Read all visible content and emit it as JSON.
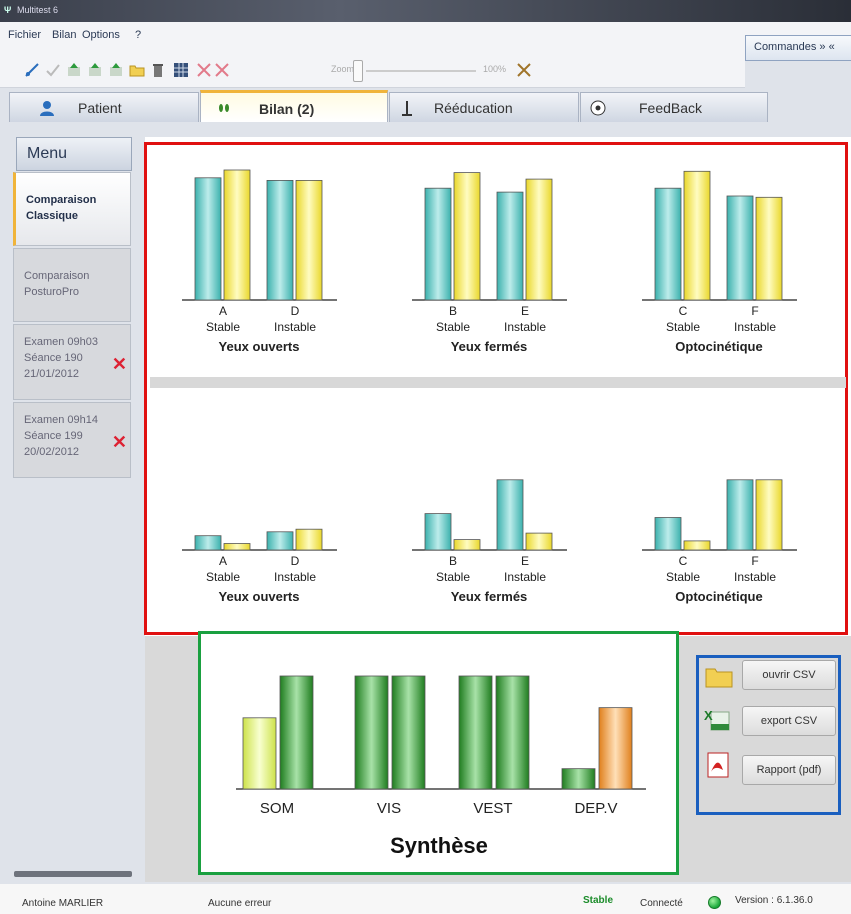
{
  "window": {
    "title": "Multitest 6"
  },
  "menu": {
    "items": [
      "Fichier",
      "Bilan",
      "Options",
      "?"
    ],
    "commands_button": "Commandes » «"
  },
  "toolbar": {
    "zoom_label": "Zoom :",
    "zoom_value": "100%"
  },
  "tabs": [
    {
      "label": "Patient",
      "active": false,
      "icon": "user-icon"
    },
    {
      "label": "Bilan (2)",
      "active": true,
      "icon": "footprints-icon"
    },
    {
      "label": "Rééducation",
      "active": false,
      "icon": "balance-icon"
    },
    {
      "label": "FeedBack",
      "active": false,
      "icon": "ball-icon"
    }
  ],
  "sidebar": {
    "header": "Menu",
    "items": [
      {
        "lines": [
          "Comparaison",
          "Classique"
        ],
        "active": true,
        "deletable": false
      },
      {
        "lines": [
          "Comparaison",
          "PosturoPro"
        ],
        "active": false,
        "deletable": false
      },
      {
        "lines": [
          "Examen 09h03",
          "Séance 190",
          "21/01/2012"
        ],
        "active": false,
        "deletable": true
      },
      {
        "lines": [
          "Examen 09h14",
          "Séance 199",
          "20/02/2012"
        ],
        "active": false,
        "deletable": true
      }
    ]
  },
  "actions": {
    "open_csv": "ouvrir CSV",
    "export_csv": "export CSV",
    "report_pdf": "Rapport (pdf)"
  },
  "status": {
    "user": "Antoine MARLIER",
    "error": "Aucune erreur",
    "state": "Stable",
    "connection": "Connecté",
    "version": "Version : 6.1.36.0"
  },
  "colors": {
    "teal": "#5cc4c0",
    "yellow": "#fff36a",
    "green": "#2f9a2f",
    "orange": "#f59c3a",
    "highlight_red": "#e01010",
    "highlight_green": "#1aa040",
    "highlight_blue": "#1a5fbf"
  },
  "chart_data": [
    {
      "type": "bar",
      "row": "top",
      "groups": [
        {
          "title": "Yeux ouverts",
          "categories": [
            "A\nStable",
            "D\nInstable"
          ],
          "series": [
            {
              "values": [
                0.94,
                0.92
              ]
            },
            {
              "values": [
                1.0,
                0.92
              ]
            }
          ]
        },
        {
          "title": "Yeux fermés",
          "categories": [
            "B\nStable",
            "E\nInstable"
          ],
          "series": [
            {
              "values": [
                0.86,
                0.83
              ]
            },
            {
              "values": [
                0.98,
                0.93
              ]
            }
          ]
        },
        {
          "title": "Optocinétique",
          "categories": [
            "C\nStable",
            "F\nInstable"
          ],
          "series": [
            {
              "values": [
                0.86,
                0.8
              ]
            },
            {
              "values": [
                0.99,
                0.79
              ]
            }
          ]
        }
      ]
    },
    {
      "type": "bar",
      "row": "bottom",
      "groups": [
        {
          "title": "Yeux ouverts",
          "categories": [
            "A\nStable",
            "D\nInstable"
          ],
          "series": [
            {
              "values": [
                0.11,
                0.14
              ]
            },
            {
              "values": [
                0.05,
                0.16
              ]
            }
          ]
        },
        {
          "title": "Yeux fermés",
          "categories": [
            "B\nStable",
            "E\nInstable"
          ],
          "series": [
            {
              "values": [
                0.28,
                0.54
              ]
            },
            {
              "values": [
                0.08,
                0.13
              ]
            }
          ]
        },
        {
          "title": "Optocinétique",
          "categories": [
            "C\nStable",
            "F\nInstable"
          ],
          "series": [
            {
              "values": [
                0.25,
                0.54
              ]
            },
            {
              "values": [
                0.07,
                0.54
              ]
            }
          ]
        }
      ]
    },
    {
      "type": "bar",
      "title": "Synthèse",
      "categories": [
        "SOM",
        "VIS",
        "VEST",
        "DEP.V"
      ],
      "series": [
        {
          "values": [
            0.63,
            1.0,
            1.0,
            0.18
          ]
        },
        {
          "values": [
            1.0,
            1.0,
            1.0,
            0.72
          ]
        }
      ]
    }
  ]
}
